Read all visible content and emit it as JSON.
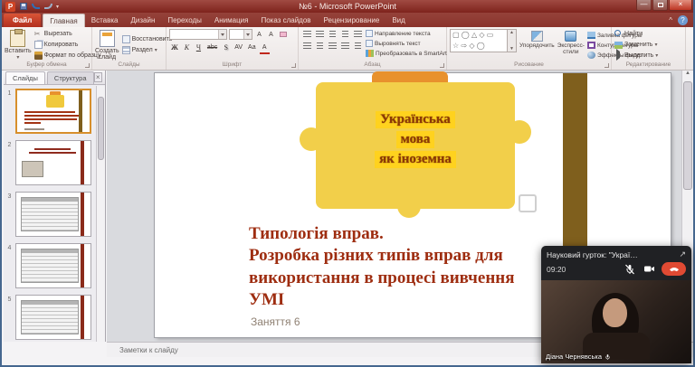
{
  "window": {
    "title": "№6 - Microsoft PowerPoint"
  },
  "icons": {
    "logo": "P",
    "min": "—",
    "close": "×",
    "caret": "▾",
    "collapse": "^",
    "help": "?",
    "expand": "↗",
    "scissors": "✂",
    "up": "▲",
    "down": "▼"
  },
  "ribbon": {
    "file_tab": "Файл",
    "tabs": [
      "Главная",
      "Вставка",
      "Дизайн",
      "Переходы",
      "Анимация",
      "Показ слайдов",
      "Рецензирование",
      "Вид"
    ],
    "clipboard": {
      "label": "Буфер обмена",
      "paste": "Вставить",
      "cut": "Вырезать",
      "copy": "Копировать",
      "format_painter": "Формат по образцу"
    },
    "slides": {
      "label": "Слайды",
      "new_slide_1": "Создать",
      "new_slide_2": "слайд",
      "reset": "Восстановить",
      "section": "Раздел"
    },
    "font": {
      "label": "Шрифт",
      "bold": "Ж",
      "italic": "К",
      "underline": "Ч",
      "strike": "abc",
      "shadow": "S",
      "spacing": "AV",
      "case": "Аа",
      "grow": "А",
      "shrink": "А",
      "clear": "А",
      "color": "А"
    },
    "paragraph": {
      "label": "Абзац",
      "text_direction": "Направление текста",
      "align_text": "Выровнять текст",
      "smartart": "Преобразовать в SmartArt"
    },
    "drawing": {
      "label": "Рисование",
      "shapes_row1": "▢ ◯ △ ◇ ▭",
      "shapes_row2": "☆ ⇨ ◇ ◯",
      "arrange": "Упорядочить",
      "quick_styles": "Экспресс-стили",
      "shape_fill": "Заливка фигуры",
      "shape_outline": "Контур фигуры",
      "shape_effects": "Эффекты фигур"
    },
    "editing": {
      "label": "Редактирование",
      "find": "Найти",
      "replace": "Заменить",
      "select": "Выделить"
    }
  },
  "left_panel": {
    "tab_slides": "Слайды",
    "tab_outline": "Структура",
    "slides": [
      "1",
      "2",
      "3",
      "4",
      "5"
    ]
  },
  "slide": {
    "puzzle_lines": [
      "Українська",
      "мова",
      "як  іноземна"
    ],
    "title_lines": [
      "Типологія вправ.",
      "Розробка різних типів вправ для",
      "використання в процесі вивчення",
      "УМІ"
    ],
    "subtitle": "Заняття 6"
  },
  "notes": {
    "label": "Заметки к слайду"
  },
  "call": {
    "title": "Науковий гурток: \"Украї…",
    "timer": "09:20",
    "participant": "Діана Чернявська"
  },
  "colors": {
    "titlebar": "#8c2e27",
    "file_button": "#c23b2a",
    "slide_title": "#9e2d10",
    "puzzle_yellow": "#ffd21e",
    "puzzle_orange": "#e8912d",
    "stripe_brown": "#7f5f1d",
    "hangup_red": "#e04a33"
  }
}
